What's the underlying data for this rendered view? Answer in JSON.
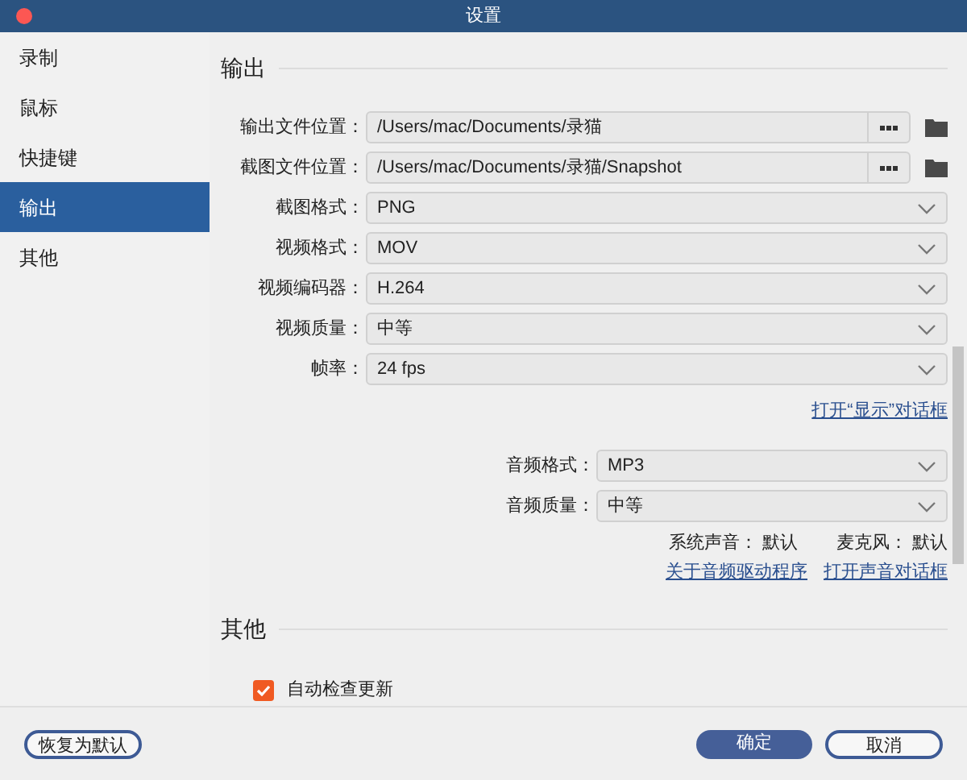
{
  "window": {
    "title": "设置"
  },
  "sidebar": {
    "items": [
      {
        "label": "录制",
        "selected": false
      },
      {
        "label": "鼠标",
        "selected": false
      },
      {
        "label": "快捷键",
        "selected": false
      },
      {
        "label": "输出",
        "selected": true
      },
      {
        "label": "其他",
        "selected": false
      }
    ]
  },
  "output_section": {
    "title": "输出",
    "path_fields": [
      {
        "label": "输出文件位置：",
        "value": "/Users/mac/Documents/录猫"
      },
      {
        "label": "截图文件位置：",
        "value": "/Users/mac/Documents/录猫/Snapshot"
      }
    ],
    "selects": [
      {
        "label": "截图格式：",
        "value": "PNG"
      },
      {
        "label": "视频格式：",
        "value": "MOV"
      },
      {
        "label": "视频编码器：",
        "value": "H.264"
      },
      {
        "label": "视频质量：",
        "value": "中等"
      },
      {
        "label": "帧率：",
        "value": "24 fps"
      }
    ],
    "display_link": "打开“显示”对话框",
    "audio_selects": [
      {
        "label": "音频格式：",
        "value": "MP3"
      },
      {
        "label": "音频质量：",
        "value": "中等"
      }
    ],
    "audio_devices": [
      {
        "label": "系统声音：",
        "value": "默认"
      },
      {
        "label": "麦克风：",
        "value": "默认"
      }
    ],
    "audio_links": [
      "关于音频驱动程序",
      "打开声音对话框"
    ]
  },
  "other_section": {
    "title": "其他",
    "checkbox": {
      "label": "自动检查更新",
      "checked": true
    }
  },
  "footer": {
    "reset_button": "恢复为默认",
    "ok_button": "确定",
    "cancel_button": "取消"
  }
}
